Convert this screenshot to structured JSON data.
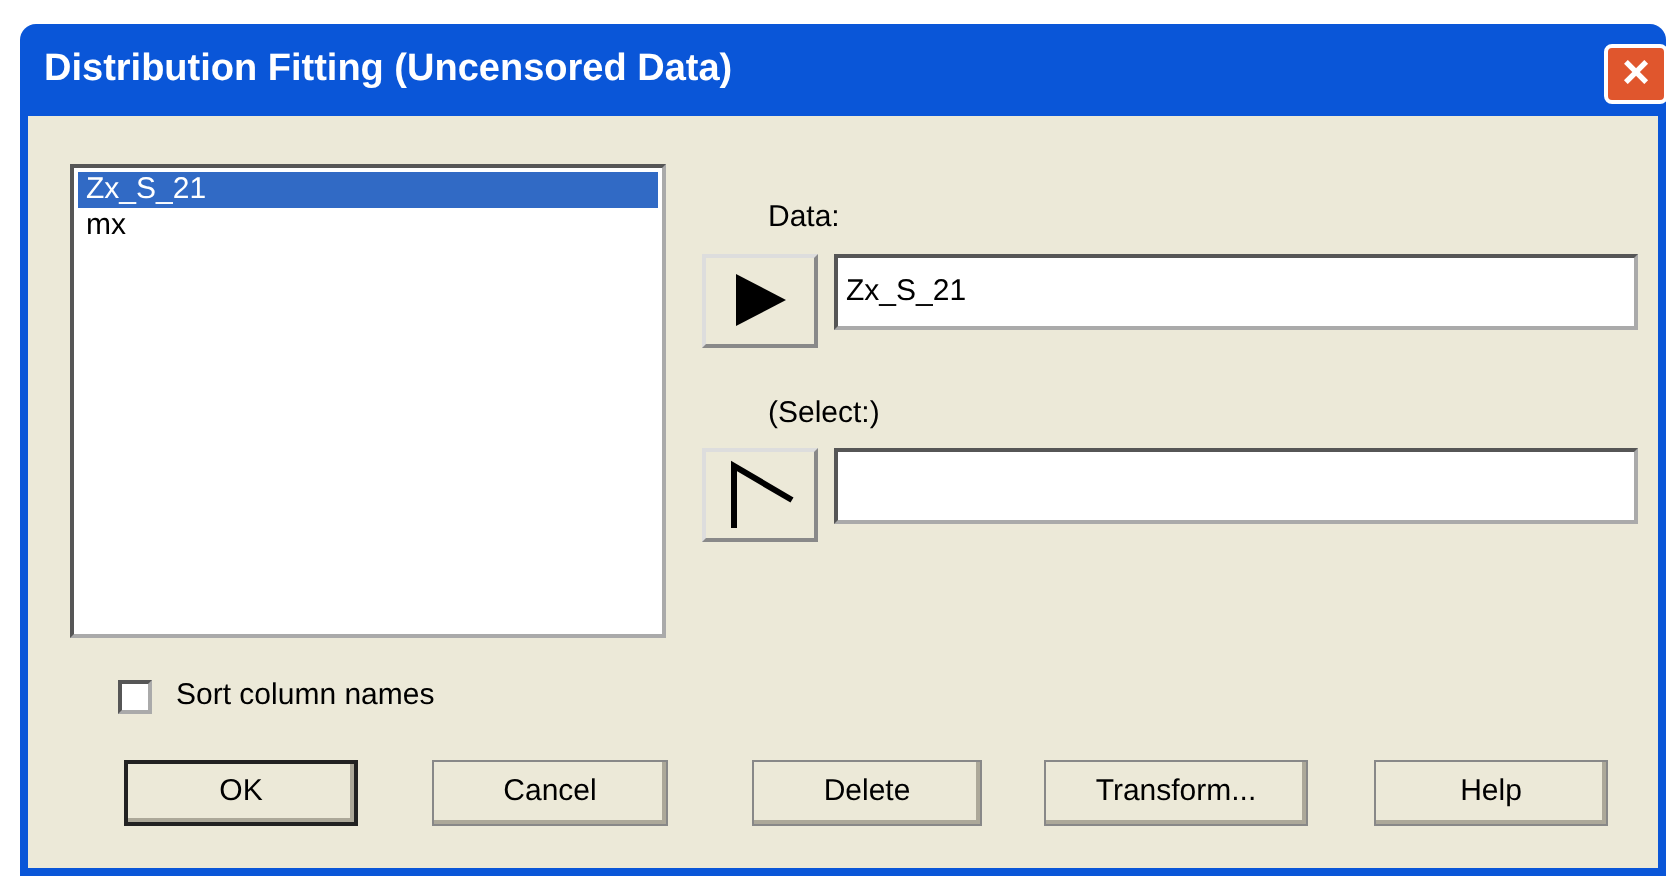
{
  "window": {
    "title": "Distribution Fitting (Uncensored Data)",
    "close": "×"
  },
  "columns": [
    {
      "label": "Zx_S_21",
      "selected": true
    },
    {
      "label": "mx",
      "selected": false
    }
  ],
  "fields": [
    {
      "label": "Data:",
      "kind": "arrow",
      "value": "Zx_S_21"
    },
    {
      "label": "(Select:)",
      "kind": "select"
    }
  ],
  "sort": {
    "label": "Sort column names",
    "checked": false
  },
  "buttons": [
    {
      "label": "OK",
      "default": true
    },
    {
      "label": "Cancel",
      "default": false
    },
    {
      "label": "Delete",
      "default": false
    },
    {
      "label": "Transform...",
      "default": false
    },
    {
      "label": "Help",
      "default": false
    }
  ]
}
